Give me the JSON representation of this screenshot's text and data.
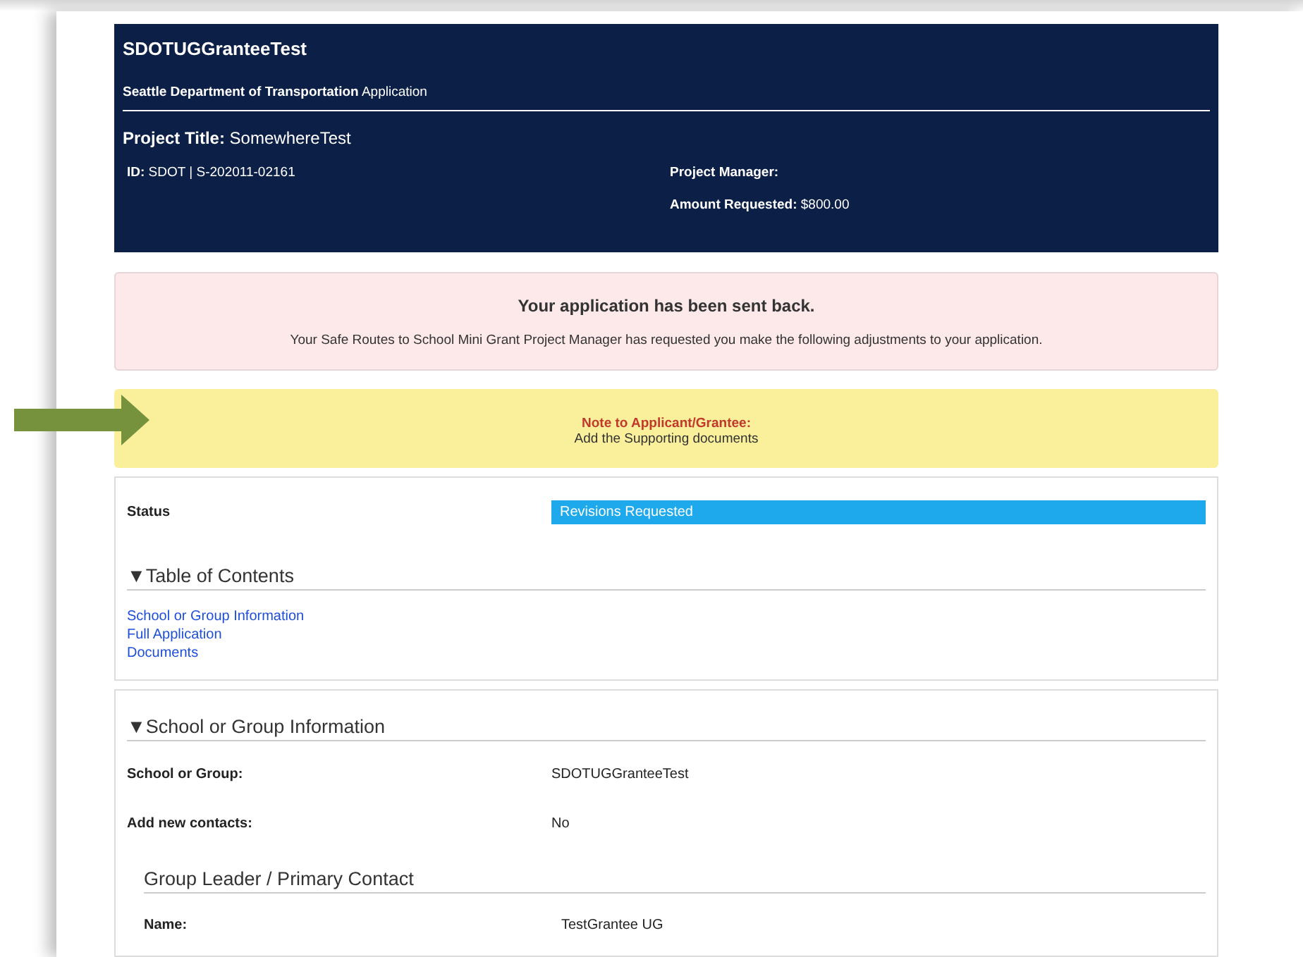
{
  "header": {
    "grantee": "SDOTUGGranteeTest",
    "subtitle": "**Seattle Department of Transportation** Application",
    "project_title": "**Project Title:** SomewhereTest",
    "id": "**ID:** SDOT | S-202011-02161",
    "project_manager": "Project Manager:",
    "amount": "**Amount Requested:** $800.00"
  },
  "alert": {
    "title": "Your application has been sent back.",
    "message": "Your Safe Routes to School Mini Grant Project Manager has requested you make the following adjustments to your application."
  },
  "note": {
    "label": "Note to Applicant/Grantee:",
    "text": "Add the Supporting documents"
  },
  "status": {
    "label": "Status",
    "value": "Revisions Requested"
  },
  "toc": {
    "toggle": "▼",
    "title": "Table of Contents",
    "links": [
      "School or Group Information",
      "Full Application",
      "Documents"
    ]
  },
  "section": {
    "toggle": "▼",
    "title": "School or Group Information",
    "fields": [
      {
        "label": "School or Group:",
        "value": "SDOTUGGranteeTest"
      },
      {
        "label": "Add new contacts:",
        "value": "No"
      }
    ],
    "subsection": {
      "title": "Group Leader / Primary Contact",
      "fields": [
        {
          "label": "Name:",
          "value": "TestGrantee UG"
        }
      ]
    }
  }
}
